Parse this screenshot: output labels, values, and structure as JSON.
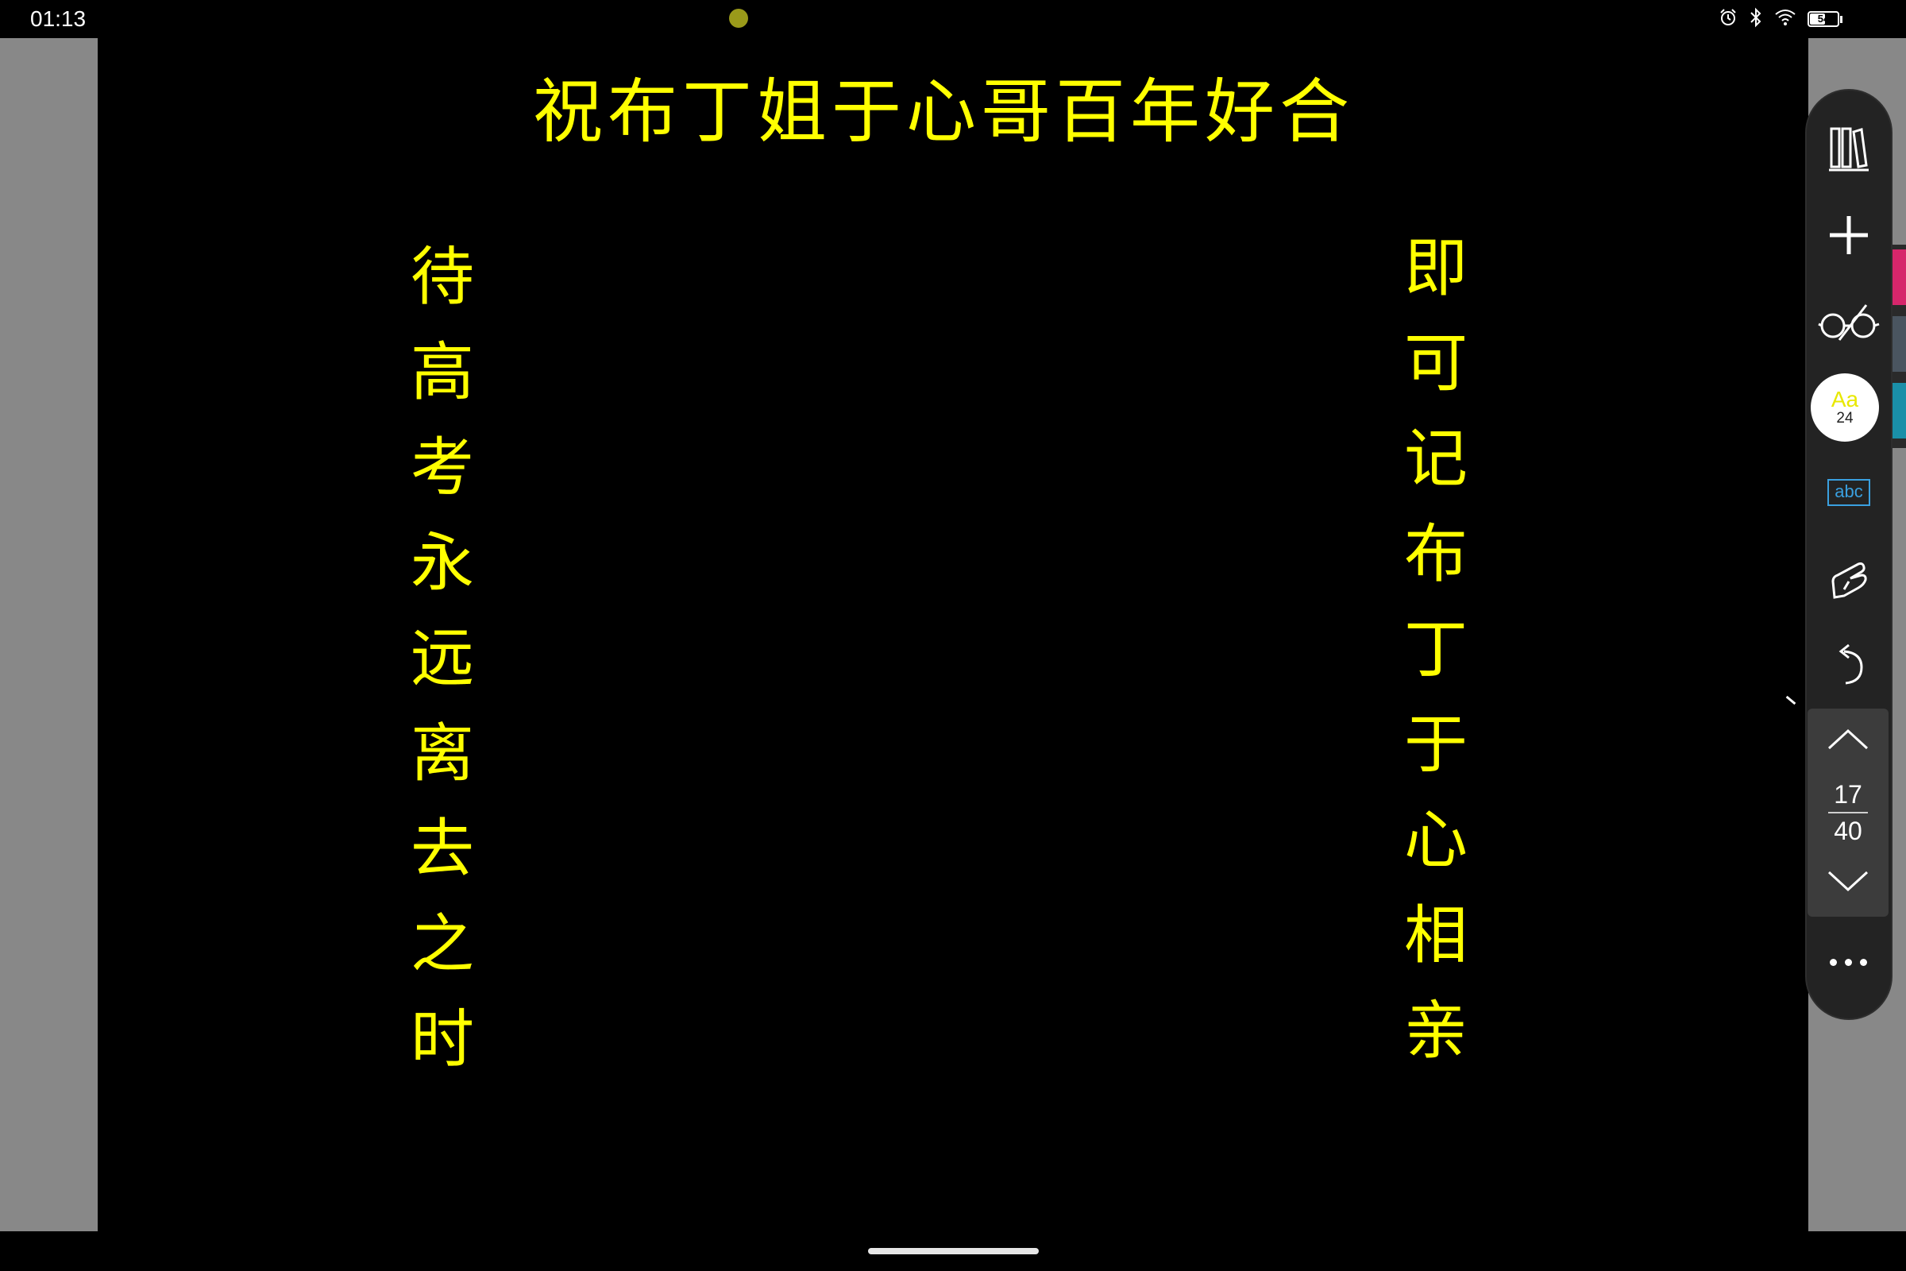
{
  "status_bar": {
    "time": "01:13",
    "battery_level": "54",
    "icons": [
      "alarm-icon",
      "bluetooth-icon",
      "wifi-icon",
      "battery-icon"
    ]
  },
  "document": {
    "title": "祝布丁姐于心哥百年好合",
    "left_column": [
      "待",
      "高",
      "考",
      "永",
      "远",
      "离",
      "去",
      "之",
      "时"
    ],
    "right_column": [
      "即",
      "可",
      "记",
      "布",
      "丁",
      "于",
      "心",
      "相",
      "亲"
    ],
    "text_color": "#ffff00",
    "background_color": "#000000"
  },
  "toolbar": {
    "buttons": [
      "bookshelf-icon",
      "add-icon",
      "reading-glasses-icon",
      "font-settings",
      "text-recognition-icon",
      "touch-gesture-icon",
      "undo-icon"
    ],
    "font_label": "Aa",
    "font_size": "24",
    "abc_label": "abc"
  },
  "pager": {
    "current_page": "17",
    "total_pages": "40"
  },
  "side_tabs": {
    "colors": [
      "#d6266b",
      "#4a5560",
      "#1a8fa8"
    ]
  }
}
